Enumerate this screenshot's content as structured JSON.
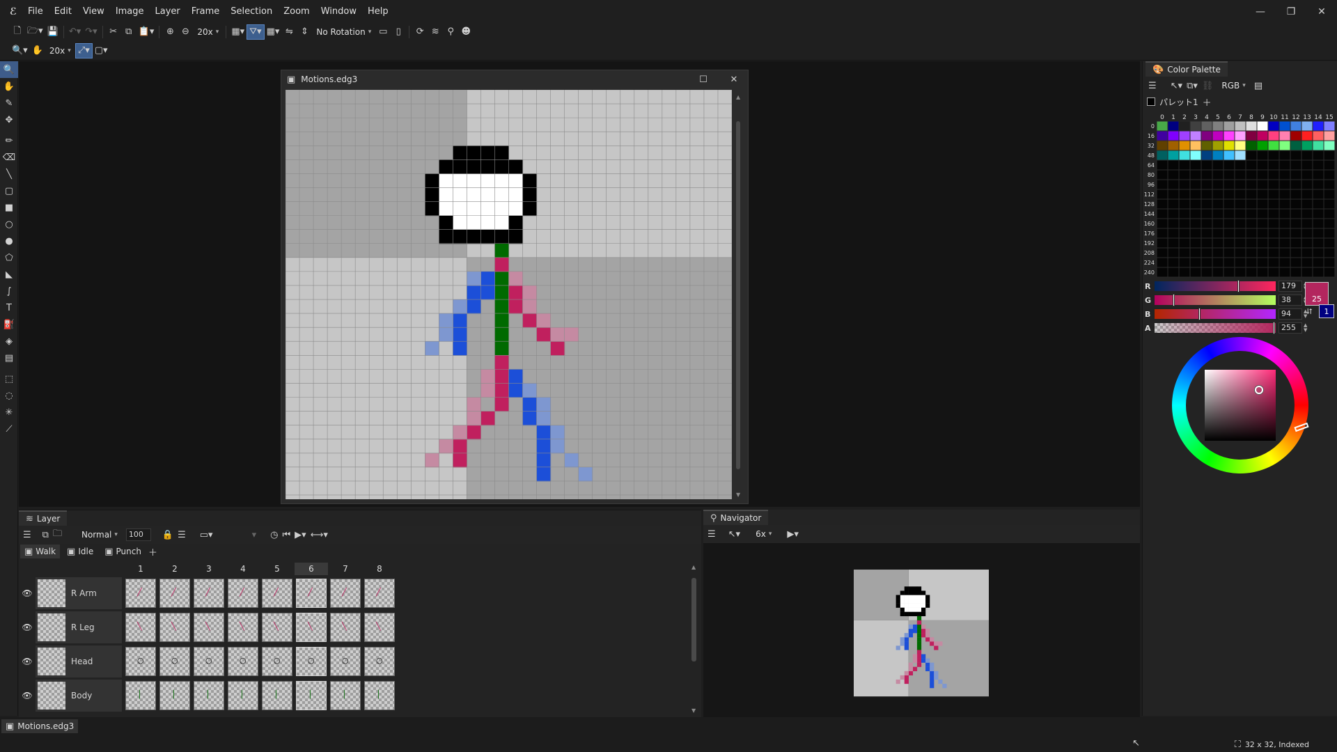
{
  "menubar": {
    "items": [
      "File",
      "Edit",
      "View",
      "Image",
      "Layer",
      "Frame",
      "Selection",
      "Zoom",
      "Window",
      "Help"
    ]
  },
  "toolbar": {
    "zoom1": "20x",
    "rotation": "No Rotation",
    "zoom2": "20x"
  },
  "document": {
    "title": "Motions.edg3"
  },
  "palette": {
    "panel_title": "Color Palette",
    "mode": "RGB",
    "palette_name": "パレット1",
    "col_headers": [
      "0",
      "1",
      "2",
      "3",
      "4",
      "5",
      "6",
      "7",
      "8",
      "9",
      "10",
      "11",
      "12",
      "13",
      "14",
      "15"
    ],
    "row_headers": [
      "0",
      "16",
      "32",
      "48",
      "64",
      "80",
      "96",
      "112",
      "128",
      "144",
      "160",
      "176",
      "192",
      "208",
      "224",
      "240"
    ],
    "colors": [
      [
        "#48a848",
        "#000080",
        "#202020",
        "#404040",
        "#606060",
        "#808080",
        "#a0a0a0",
        "#c0c0c0",
        "#e0e0e0",
        "#ffffff",
        "#0000c0",
        "#0050d0",
        "#4080e0",
        "#80b0f0",
        "#2020ff",
        "#8080ff"
      ],
      [
        "#4000a0",
        "#8000ff",
        "#a040ff",
        "#c080ff",
        "#800080",
        "#c000c0",
        "#ff40ff",
        "#ffa0ff",
        "#800040",
        "#c00060",
        "#ff4080",
        "#ff80b0",
        "#a00000",
        "#ff2020",
        "#ff6060",
        "#ffa0a0"
      ],
      [
        "#604000",
        "#a06000",
        "#e09000",
        "#ffc060",
        "#606000",
        "#a0a000",
        "#e0e000",
        "#ffff80",
        "#006000",
        "#00a000",
        "#40e040",
        "#80ff80",
        "#006040",
        "#00a060",
        "#40e0a0",
        "#80ffc0"
      ],
      [
        "#006060",
        "#00a0a0",
        "#40e0e0",
        "#80ffff",
        "#004080",
        "#0080c0",
        "#40c0ff",
        "#a0e0ff",
        "",
        "",
        "",
        "",
        "",
        "",
        "",
        ""
      ]
    ],
    "r": {
      "label": "R",
      "value": "179",
      "fraction": 0.7
    },
    "g": {
      "label": "G",
      "value": "38",
      "fraction": 0.15
    },
    "b": {
      "label": "B",
      "value": "94",
      "fraction": 0.37
    },
    "a": {
      "label": "A",
      "value": "255",
      "fraction": 1.0
    },
    "fg_index": "25",
    "bg_index": "1",
    "fg_color": "#b3265e",
    "bg_color": "#000080"
  },
  "layer_panel": {
    "title": "Layer",
    "blend": "Normal",
    "opacity": "100",
    "tabs": [
      "Walk",
      "Idle",
      "Punch"
    ],
    "frames": [
      "1",
      "2",
      "3",
      "4",
      "5",
      "6",
      "7",
      "8"
    ],
    "selected_frame": 6,
    "layers": [
      {
        "name": "R Arm"
      },
      {
        "name": "R Leg"
      },
      {
        "name": "Head"
      },
      {
        "name": "Body"
      }
    ]
  },
  "navigator": {
    "title": "Navigator",
    "zoom": "6x"
  },
  "status": {
    "doc_tab": "Motions.edg3",
    "info": "32 x 32, Indexed"
  },
  "sprite": {
    "grid": 32,
    "pixels": [
      {
        "c": "#000",
        "cells": [
          [
            12,
            4
          ],
          [
            13,
            4
          ],
          [
            14,
            4
          ],
          [
            15,
            4
          ],
          [
            11,
            5
          ],
          [
            16,
            5
          ],
          [
            12,
            5
          ],
          [
            13,
            5
          ],
          [
            14,
            5
          ],
          [
            15,
            5
          ],
          [
            10,
            6
          ],
          [
            17,
            6
          ],
          [
            10,
            7
          ],
          [
            17,
            7
          ],
          [
            10,
            8
          ],
          [
            17,
            8
          ],
          [
            11,
            9
          ],
          [
            16,
            9
          ],
          [
            12,
            10
          ],
          [
            13,
            10
          ],
          [
            14,
            10
          ],
          [
            15,
            10
          ],
          [
            11,
            10
          ],
          [
            16,
            10
          ]
        ]
      }
    ]
  }
}
